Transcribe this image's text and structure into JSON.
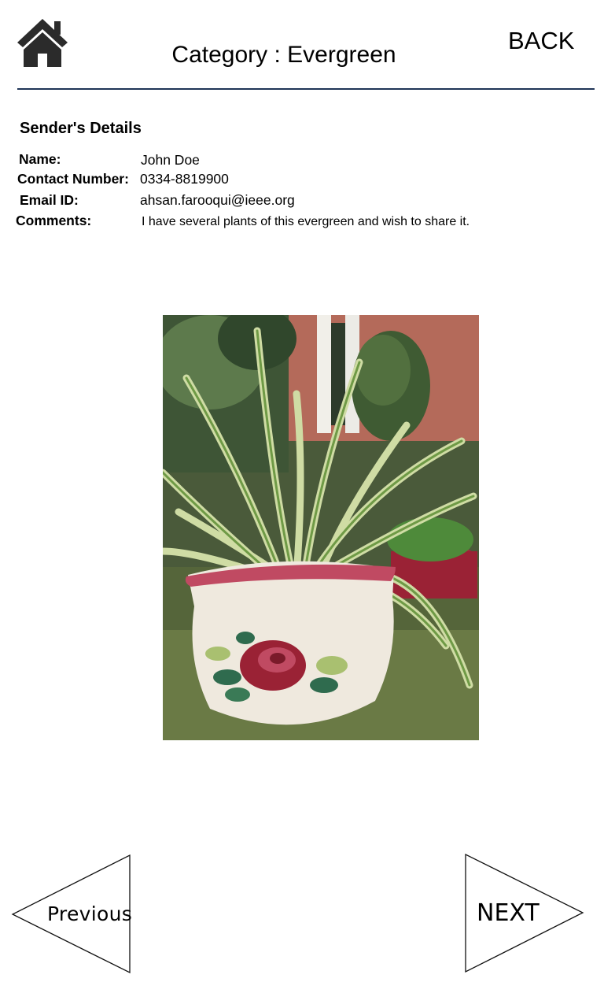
{
  "header": {
    "home_icon": "home-icon",
    "title": "Category : Evergreen",
    "back_label": "BACK"
  },
  "sender": {
    "section_title": "Sender's Details",
    "name_label": "Name:",
    "name_value": "John Doe",
    "contact_label": "Contact Number:",
    "contact_value": "0334-8819900",
    "email_label": "Email ID:",
    "email_value": "ahsan.farooqui@ieee.org",
    "comments_label": "Comments:",
    "comments_value": "I have several plants of this evergreen and wish to share it."
  },
  "photo": {
    "subject": "plant-photo"
  },
  "navigation": {
    "previous_label": "Previous",
    "next_label": "NEXT"
  },
  "colors": {
    "divider": "#1f3557",
    "icon": "#2b2b2b"
  }
}
